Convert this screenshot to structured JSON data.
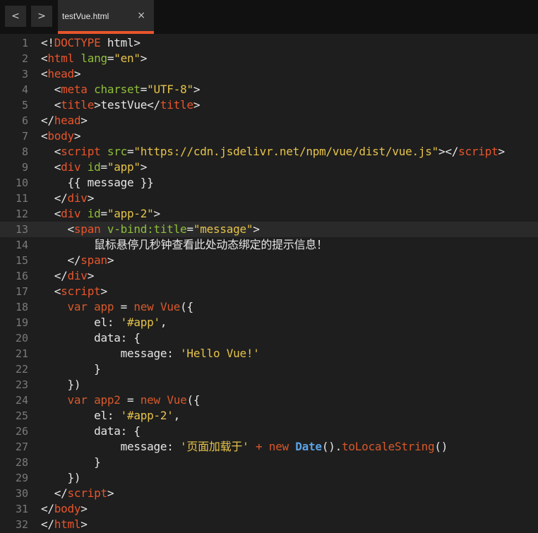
{
  "nav": {
    "back": "<",
    "forward": ">"
  },
  "tab": {
    "title": "testVue.html",
    "close": "×"
  },
  "editor": {
    "active_line": 13,
    "lines": [
      {
        "n": "1",
        "tokens": [
          {
            "t": "<!",
            "c": "txt"
          },
          {
            "t": "DOCTYPE",
            "c": "tag"
          },
          {
            "t": " html>",
            "c": "txt"
          }
        ]
      },
      {
        "n": "2",
        "tokens": [
          {
            "t": "<",
            "c": "txt"
          },
          {
            "t": "html",
            "c": "tag"
          },
          {
            "t": " ",
            "c": "txt"
          },
          {
            "t": "lang",
            "c": "attr"
          },
          {
            "t": "=",
            "c": "txt"
          },
          {
            "t": "\"en\"",
            "c": "str"
          },
          {
            "t": ">",
            "c": "txt"
          }
        ]
      },
      {
        "n": "3",
        "tokens": [
          {
            "t": "<",
            "c": "txt"
          },
          {
            "t": "head",
            "c": "tag"
          },
          {
            "t": ">",
            "c": "txt"
          }
        ]
      },
      {
        "n": "4",
        "tokens": [
          {
            "t": "  <",
            "c": "txt"
          },
          {
            "t": "meta",
            "c": "tag"
          },
          {
            "t": " ",
            "c": "txt"
          },
          {
            "t": "charset",
            "c": "attr"
          },
          {
            "t": "=",
            "c": "txt"
          },
          {
            "t": "\"UTF-8\"",
            "c": "str"
          },
          {
            "t": ">",
            "c": "txt"
          }
        ]
      },
      {
        "n": "5",
        "tokens": [
          {
            "t": "  <",
            "c": "txt"
          },
          {
            "t": "title",
            "c": "tag"
          },
          {
            "t": ">testVue</",
            "c": "txt"
          },
          {
            "t": "title",
            "c": "tag"
          },
          {
            "t": ">",
            "c": "txt"
          }
        ]
      },
      {
        "n": "6",
        "tokens": [
          {
            "t": "</",
            "c": "txt"
          },
          {
            "t": "head",
            "c": "tag"
          },
          {
            "t": ">",
            "c": "txt"
          }
        ]
      },
      {
        "n": "7",
        "tokens": [
          {
            "t": "<",
            "c": "txt"
          },
          {
            "t": "body",
            "c": "tag"
          },
          {
            "t": ">",
            "c": "txt"
          }
        ]
      },
      {
        "n": "8",
        "tokens": [
          {
            "t": "  <",
            "c": "txt"
          },
          {
            "t": "script",
            "c": "tag"
          },
          {
            "t": " ",
            "c": "txt"
          },
          {
            "t": "src",
            "c": "attr"
          },
          {
            "t": "=",
            "c": "txt"
          },
          {
            "t": "\"https://cdn.jsdelivr.net/npm/vue/dist/vue.js\"",
            "c": "str"
          },
          {
            "t": "></",
            "c": "txt"
          },
          {
            "t": "script",
            "c": "tag"
          },
          {
            "t": ">",
            "c": "txt"
          }
        ]
      },
      {
        "n": "9",
        "tokens": [
          {
            "t": "  <",
            "c": "txt"
          },
          {
            "t": "div",
            "c": "tag"
          },
          {
            "t": " ",
            "c": "txt"
          },
          {
            "t": "id",
            "c": "attr"
          },
          {
            "t": "=",
            "c": "txt"
          },
          {
            "t": "\"app\"",
            "c": "str"
          },
          {
            "t": ">",
            "c": "txt"
          }
        ]
      },
      {
        "n": "10",
        "tokens": [
          {
            "t": "    {{ message }}",
            "c": "txt"
          }
        ]
      },
      {
        "n": "11",
        "tokens": [
          {
            "t": "  </",
            "c": "txt"
          },
          {
            "t": "div",
            "c": "tag"
          },
          {
            "t": ">",
            "c": "txt"
          }
        ]
      },
      {
        "n": "12",
        "tokens": [
          {
            "t": "  <",
            "c": "txt"
          },
          {
            "t": "div",
            "c": "tag"
          },
          {
            "t": " ",
            "c": "txt"
          },
          {
            "t": "id",
            "c": "attr"
          },
          {
            "t": "=",
            "c": "txt"
          },
          {
            "t": "\"app-2\"",
            "c": "str"
          },
          {
            "t": ">",
            "c": "txt"
          }
        ]
      },
      {
        "n": "13",
        "tokens": [
          {
            "t": "    <",
            "c": "txt"
          },
          {
            "t": "span",
            "c": "tag"
          },
          {
            "t": " ",
            "c": "txt"
          },
          {
            "t": "v-bind:title",
            "c": "attr"
          },
          {
            "t": "=",
            "c": "txt"
          },
          {
            "t": "\"message\"",
            "c": "str"
          },
          {
            "t": ">",
            "c": "txt"
          }
        ]
      },
      {
        "n": "14",
        "tokens": [
          {
            "t": "        鼠标悬停几秒钟查看此处动态绑定的提示信息！",
            "c": "txt"
          }
        ]
      },
      {
        "n": "15",
        "tokens": [
          {
            "t": "    </",
            "c": "txt"
          },
          {
            "t": "span",
            "c": "tag"
          },
          {
            "t": ">",
            "c": "txt"
          }
        ]
      },
      {
        "n": "16",
        "tokens": [
          {
            "t": "  </",
            "c": "txt"
          },
          {
            "t": "div",
            "c": "tag"
          },
          {
            "t": ">",
            "c": "txt"
          }
        ]
      },
      {
        "n": "17",
        "tokens": [
          {
            "t": "  <",
            "c": "txt"
          },
          {
            "t": "script",
            "c": "tag"
          },
          {
            "t": ">",
            "c": "txt"
          }
        ]
      },
      {
        "n": "18",
        "tokens": [
          {
            "t": "    ",
            "c": "txt"
          },
          {
            "t": "var",
            "c": "kw"
          },
          {
            "t": " ",
            "c": "txt"
          },
          {
            "t": "app",
            "c": "kw"
          },
          {
            "t": " = ",
            "c": "txt"
          },
          {
            "t": "new",
            "c": "kw"
          },
          {
            "t": " ",
            "c": "txt"
          },
          {
            "t": "Vue",
            "c": "kw"
          },
          {
            "t": "({",
            "c": "txt"
          }
        ]
      },
      {
        "n": "19",
        "tokens": [
          {
            "t": "        el: ",
            "c": "txt"
          },
          {
            "t": "'#app'",
            "c": "str"
          },
          {
            "t": ",",
            "c": "txt"
          }
        ]
      },
      {
        "n": "20",
        "tokens": [
          {
            "t": "        data: {",
            "c": "txt"
          }
        ]
      },
      {
        "n": "21",
        "tokens": [
          {
            "t": "            message: ",
            "c": "txt"
          },
          {
            "t": "'Hello Vue!'",
            "c": "str"
          }
        ]
      },
      {
        "n": "22",
        "tokens": [
          {
            "t": "        }",
            "c": "txt"
          }
        ]
      },
      {
        "n": "23",
        "tokens": [
          {
            "t": "    })",
            "c": "txt"
          }
        ]
      },
      {
        "n": "24",
        "tokens": [
          {
            "t": "    ",
            "c": "txt"
          },
          {
            "t": "var",
            "c": "kw"
          },
          {
            "t": " ",
            "c": "txt"
          },
          {
            "t": "app2",
            "c": "kw"
          },
          {
            "t": " = ",
            "c": "txt"
          },
          {
            "t": "new",
            "c": "kw"
          },
          {
            "t": " ",
            "c": "txt"
          },
          {
            "t": "Vue",
            "c": "kw"
          },
          {
            "t": "({",
            "c": "txt"
          }
        ]
      },
      {
        "n": "25",
        "tokens": [
          {
            "t": "        el: ",
            "c": "txt"
          },
          {
            "t": "'#app-2'",
            "c": "str"
          },
          {
            "t": ",",
            "c": "txt"
          }
        ]
      },
      {
        "n": "26",
        "tokens": [
          {
            "t": "        data: {",
            "c": "txt"
          }
        ]
      },
      {
        "n": "27",
        "tokens": [
          {
            "t": "            message: ",
            "c": "txt"
          },
          {
            "t": "'页面加载于'",
            "c": "str"
          },
          {
            "t": " + ",
            "c": "kw"
          },
          {
            "t": "new",
            "c": "kw"
          },
          {
            "t": " ",
            "c": "txt"
          },
          {
            "t": "Date",
            "c": "fn"
          },
          {
            "t": "().",
            "c": "txt"
          },
          {
            "t": "toLocaleString",
            "c": "kw"
          },
          {
            "t": "()",
            "c": "txt"
          }
        ]
      },
      {
        "n": "28",
        "tokens": [
          {
            "t": "        }",
            "c": "txt"
          }
        ]
      },
      {
        "n": "29",
        "tokens": [
          {
            "t": "    })",
            "c": "txt"
          }
        ]
      },
      {
        "n": "30",
        "tokens": [
          {
            "t": "  </",
            "c": "txt"
          },
          {
            "t": "script",
            "c": "tag"
          },
          {
            "t": ">",
            "c": "txt"
          }
        ]
      },
      {
        "n": "31",
        "tokens": [
          {
            "t": "</",
            "c": "txt"
          },
          {
            "t": "body",
            "c": "tag"
          },
          {
            "t": ">",
            "c": "txt"
          }
        ]
      },
      {
        "n": "32",
        "tokens": [
          {
            "t": "</",
            "c": "txt"
          },
          {
            "t": "html",
            "c": "tag"
          },
          {
            "t": ">",
            "c": "txt"
          }
        ]
      }
    ]
  }
}
